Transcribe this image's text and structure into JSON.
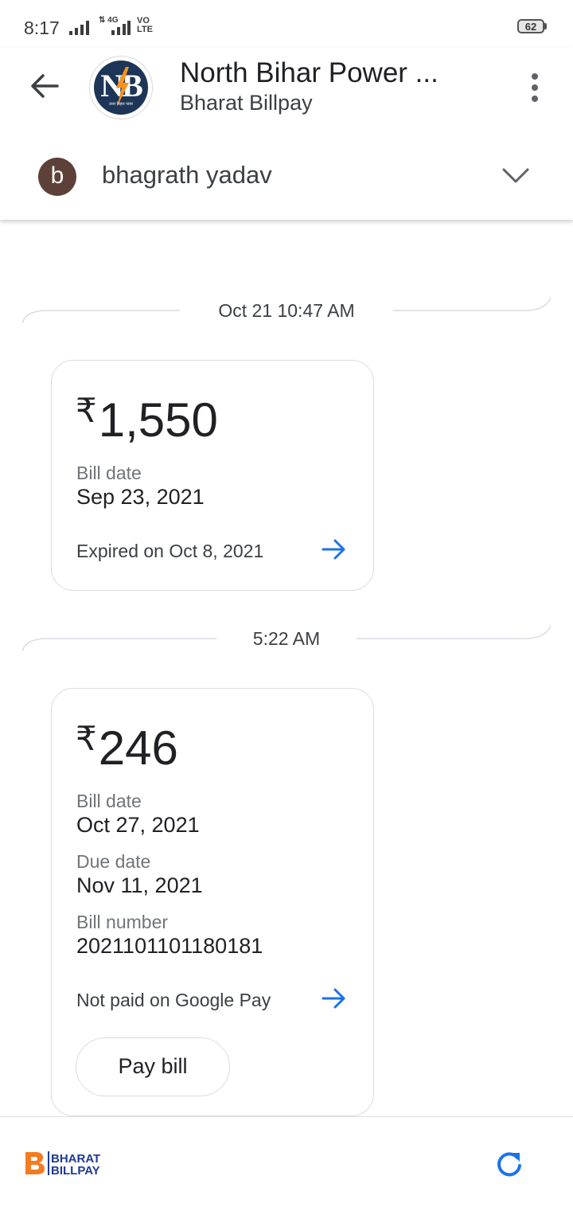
{
  "status_bar": {
    "time": "8:17",
    "network_label": "4G",
    "volte_label_1": "VO",
    "volte_label_2": "LTE",
    "battery": "62"
  },
  "header": {
    "title": "North Bihar Power ...",
    "subtitle": "Bharat Billpay",
    "logo_text": "NB",
    "logo_caption": "उत्तर बिहार पावर"
  },
  "account": {
    "avatar_letter": "b",
    "name": "bhagrath yadav"
  },
  "timeline": [
    {
      "timestamp": "Oct 21 10:47 AM",
      "card": {
        "currency": "₹",
        "amount": "1,550",
        "bill_date_label": "Bill date",
        "bill_date": "Sep 23, 2021",
        "status": "Expired on Oct 8, 2021"
      }
    },
    {
      "timestamp": "5:22 AM",
      "card": {
        "currency": "₹",
        "amount": "246",
        "bill_date_label": "Bill date",
        "bill_date": "Oct 27, 2021",
        "due_date_label": "Due date",
        "due_date": "Nov 11, 2021",
        "bill_number_label": "Bill number",
        "bill_number": "20211011011801​81",
        "status": "Not paid on Google Pay",
        "pay_button": "Pay bill"
      }
    }
  ],
  "footer": {
    "brand_line1": "BHARAT",
    "brand_line2": "BILLPAY",
    "brand_letter": "B"
  },
  "colors": {
    "accent": "#1a73e8",
    "avatar": "#5d4037",
    "logo_bg": "#1d3557",
    "bbps_orange": "#f47b20",
    "bbps_blue": "#1f3a93"
  },
  "icons": [
    "back-arrow-icon",
    "more-vert-icon",
    "chevron-down-icon",
    "arrow-right-icon",
    "refresh-icon"
  ]
}
